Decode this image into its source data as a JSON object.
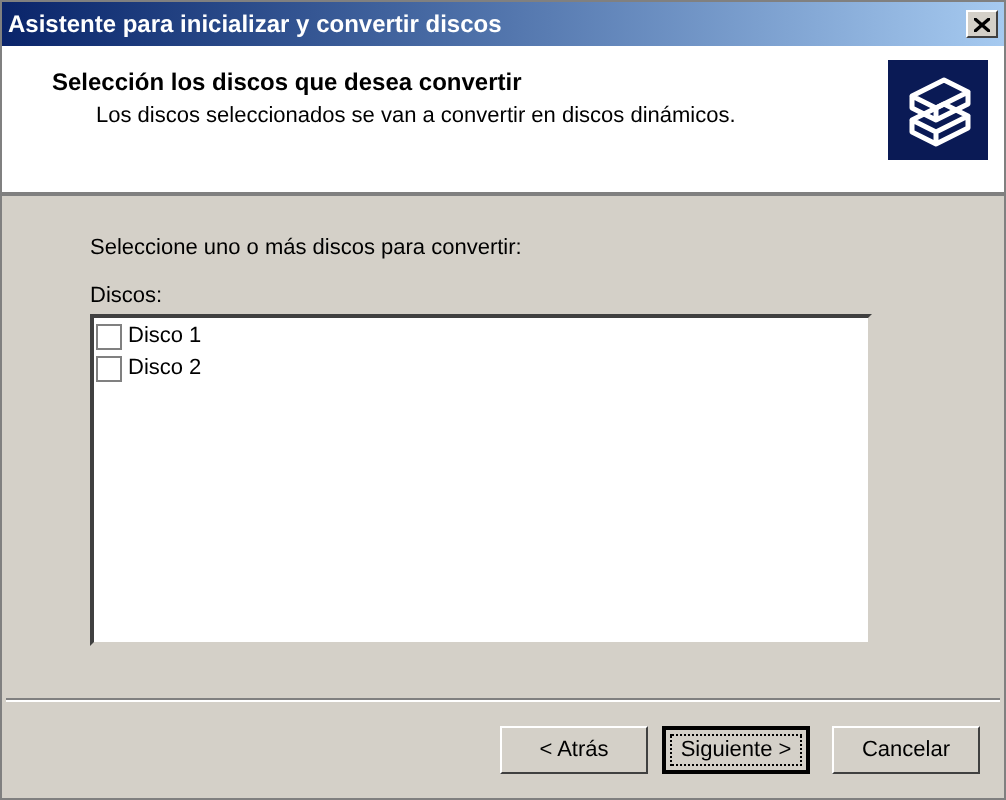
{
  "window": {
    "title": "Asistente para inicializar y convertir discos"
  },
  "header": {
    "title": "Selección los discos que desea convertir",
    "subtitle": "Los discos seleccionados se van a convertir en discos dinámicos."
  },
  "instruction": "Seleccione uno o más discos para convertir:",
  "list_label": "Discos:",
  "disks": [
    {
      "label": "Disco 1",
      "checked": false
    },
    {
      "label": "Disco 2",
      "checked": false
    }
  ],
  "buttons": [
    {
      "label": "< Atrás",
      "default": false
    },
    {
      "label": "Siguiente >",
      "default": true
    },
    {
      "label": "Cancelar",
      "default": false
    }
  ]
}
